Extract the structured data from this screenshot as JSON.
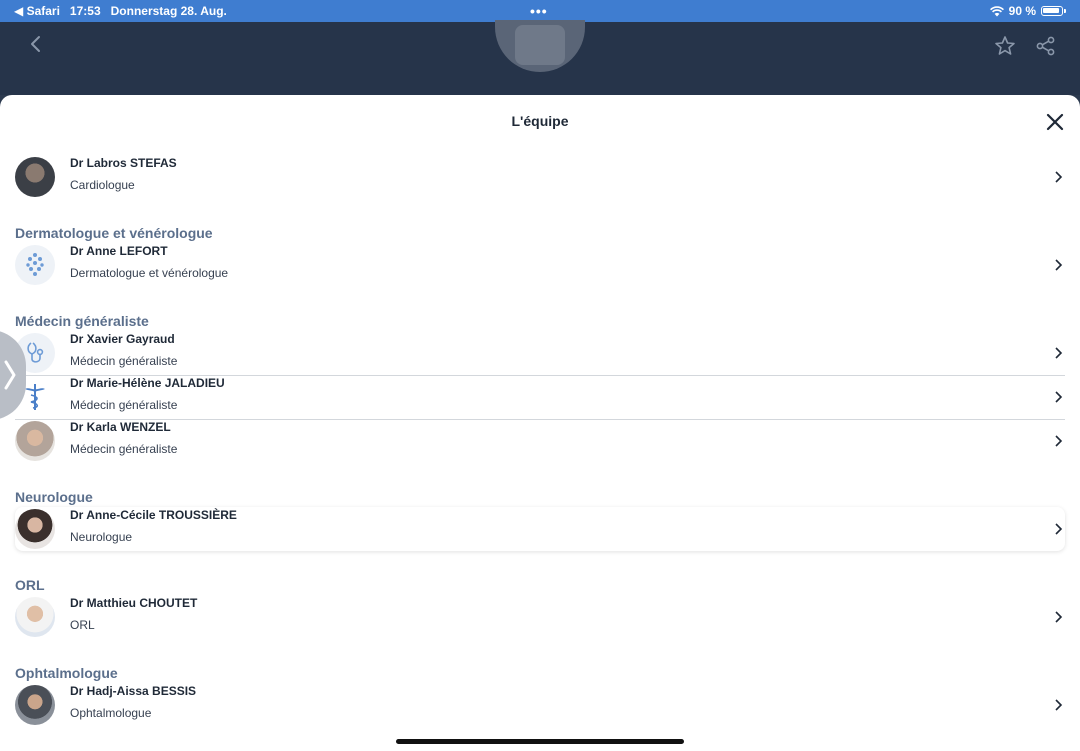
{
  "statusbar": {
    "back_app": "◀ Safari",
    "time": "17:53",
    "date": "Donnerstag 28. Aug.",
    "dots": "•••",
    "battery": "90 %"
  },
  "header": {
    "back_icon": "chevron-left-icon",
    "favorite_icon": "star-icon",
    "share_icon": "share-icon"
  },
  "sheet": {
    "title": "L'équipe",
    "close_icon": "close-icon"
  },
  "sections": [
    {
      "title": ""
    },
    {
      "title": "Dermatologue et vénérologue"
    },
    {
      "title": "Médecin généraliste"
    },
    {
      "title": "Neurologue"
    },
    {
      "title": "ORL"
    },
    {
      "title": "Ophtalmologue"
    }
  ],
  "doctors": [
    {
      "name": "Dr Labros STEFAS",
      "specialty": "Cardiologue"
    },
    {
      "name": "Dr Anne LEFORT",
      "specialty": "Dermatologue et vénérologue"
    },
    {
      "name": "Dr Xavier Gayraud",
      "specialty": "Médecin généraliste"
    },
    {
      "name": "Dr Marie-Hélène JALADIEU",
      "specialty": "Médecin généraliste"
    },
    {
      "name": "Dr Karla WENZEL",
      "specialty": "Médecin généraliste"
    },
    {
      "name": "Dr Anne-Cécile TROUSSIÈRE",
      "specialty": "Neurologue"
    },
    {
      "name": "Dr Matthieu CHOUTET",
      "specialty": "ORL"
    },
    {
      "name": "Dr Hadj-Aissa BESSIS",
      "specialty": "Ophtalmologue"
    }
  ],
  "colors": {
    "statusbar": "#3f7dd0",
    "header": "#26344a",
    "section_title": "#5b6f8c"
  }
}
